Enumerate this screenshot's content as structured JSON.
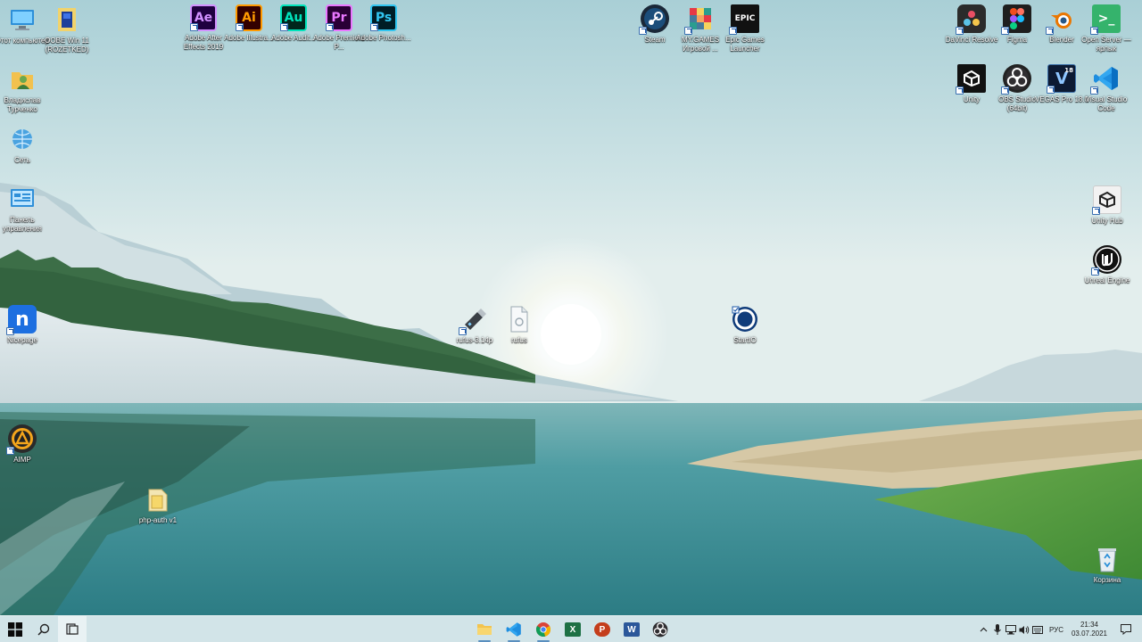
{
  "desktop": {
    "icons_left": [
      {
        "label": "Этот компьютер",
        "icon": "this-pc-icon"
      },
      {
        "label": "Владислав Турченко",
        "icon": "user-folder-icon"
      },
      {
        "label": "Сеть",
        "icon": "network-icon"
      },
      {
        "label": "Панель управления",
        "icon": "control-panel-icon"
      },
      {
        "label": "Nicepage",
        "icon": "nicepage-icon"
      },
      {
        "label": "AIMP",
        "icon": "aimp-icon"
      }
    ],
    "icon_oobe": {
      "label": "OOBE Win 11 (ROZETKED)",
      "icon": "installer-icon"
    },
    "adobe": [
      {
        "abbr": "Ae",
        "label": "Adobe After Effects 2019"
      },
      {
        "abbr": "Ai",
        "label": "Adobe Illustra..."
      },
      {
        "abbr": "Au",
        "label": "Adobe Audit..."
      },
      {
        "abbr": "Pr",
        "label": "Adobe Premiere P..."
      },
      {
        "abbr": "Ps",
        "label": "Adobe Photosh..."
      }
    ],
    "games": [
      {
        "label": "Steam",
        "icon": "steam-icon"
      },
      {
        "label": "MY.GAMES Игровой ...",
        "icon": "mygames-icon"
      },
      {
        "label": "Epic Games Launcher",
        "icon": "epic-games-icon",
        "badge": "EPIC"
      }
    ],
    "right_top": [
      {
        "label": "DaVinci Resolve",
        "icon": "davinci-icon"
      },
      {
        "label": "Figma",
        "icon": "figma-icon"
      },
      {
        "label": "Blender",
        "icon": "blender-icon"
      },
      {
        "label": "Open Server — ярлык",
        "icon": "openserver-icon"
      }
    ],
    "right_second": [
      {
        "label": "Unity",
        "icon": "unity-icon"
      },
      {
        "label": "OBS Studio (64bit)",
        "icon": "obs-icon"
      },
      {
        "label": "VEGAS Pro 18.0",
        "icon": "vegas-icon",
        "badge": "V",
        "badge_sub": "18"
      },
      {
        "label": "Visual Studio Code",
        "icon": "vscode-icon"
      }
    ],
    "right_column": [
      {
        "label": "Unity Hub",
        "icon": "unity-hub-icon"
      },
      {
        "label": "Unreal Engine",
        "icon": "unreal-icon"
      }
    ],
    "recycle_bin": {
      "label": "Корзина",
      "icon": "recycle-bin-icon"
    },
    "center": [
      {
        "label": "rufus-3.14p",
        "icon": "usb-icon"
      },
      {
        "label": "rufus",
        "icon": "file-icon"
      },
      {
        "label": "StartIO",
        "icon": "startio-icon"
      }
    ],
    "php_folder": {
      "label": "php-auth v1",
      "icon": "folder-icon"
    }
  },
  "taskbar": {
    "pinned": [
      {
        "name": "file-explorer",
        "icon": "folder-icon"
      },
      {
        "name": "vscode",
        "icon": "vscode-icon"
      },
      {
        "name": "chrome",
        "icon": "chrome-icon"
      },
      {
        "name": "excel",
        "icon": "excel-icon",
        "badge": "X"
      },
      {
        "name": "powerpoint",
        "icon": "powerpoint-icon",
        "badge": "P"
      },
      {
        "name": "word",
        "icon": "word-icon",
        "badge": "W"
      },
      {
        "name": "obs",
        "icon": "obs-icon"
      }
    ],
    "tray": {
      "language": "РУС",
      "time": "21:34",
      "date": "03.07.2021"
    }
  },
  "colors": {
    "taskbar_bg": "#d2e4e8",
    "accent": "#5a8fbf"
  }
}
